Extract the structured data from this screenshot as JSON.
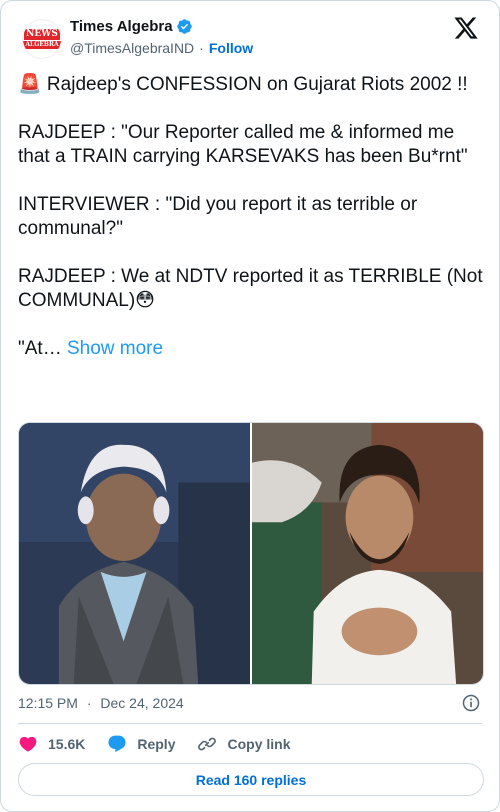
{
  "header": {
    "avatar_line1": "NEWS",
    "avatar_line2": "ALGEBRA",
    "display_name": "Times Algebra",
    "handle": "@TimesAlgebraIND",
    "separator": "·",
    "follow_label": "Follow"
  },
  "tweet": {
    "text": "🚨 Rajdeep's CONFESSION on Gujarat Riots 2002 !!\n\nRAJDEEP : \"Our Reporter called me & informed me that a TRAIN carrying KARSEVAKS has been Bu*rnt\"\n\nINTERVIEWER : \"Did you report it as terrible or communal?\"\n\nRAJDEEP : We at NDTV reported it as TERRIBLE (Not COMMUNAL)😳\n\n\"At… ",
    "show_more": "Show more"
  },
  "meta": {
    "time": "12:15 PM",
    "separator": "·",
    "date": "Dec 24, 2024"
  },
  "actions": {
    "likes": "15.6K",
    "reply_label": "Reply",
    "copy_label": "Copy link"
  },
  "read_replies_label": "Read 160 replies",
  "colors": {
    "accent": "#1d9bf0",
    "link": "#006fd6",
    "like": "#f91880",
    "muted": "#536471",
    "border": "#cfd9de"
  },
  "icons": [
    "verified-badge-icon",
    "x-logo-icon",
    "info-icon",
    "heart-icon",
    "reply-bubble-icon",
    "link-icon"
  ]
}
